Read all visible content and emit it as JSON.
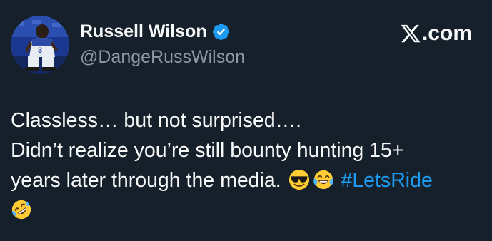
{
  "author": {
    "display_name": "Russell Wilson",
    "handle": "@DangeRussWilson",
    "verified": true,
    "avatar_icon": "profile-photo"
  },
  "brand": {
    "text": ".com",
    "logo_icon": "x-logo-icon"
  },
  "tweet": {
    "line1": "Classless… but not surprised….",
    "line2": "Didn’t realize you’re still bounty hunting 15+",
    "line3_text": "years later through the media.",
    "emojis": [
      "smiling-face-with-sunglasses",
      "face-with-tears-of-joy",
      "rolling-on-the-floor-laughing"
    ],
    "hashtag": "#LetsRide"
  },
  "colors": {
    "background": "#15202b",
    "text": "#f7f9f9",
    "secondary": "#8b98a5",
    "link": "#1d9bf0",
    "verified": "#1d9bf0"
  }
}
